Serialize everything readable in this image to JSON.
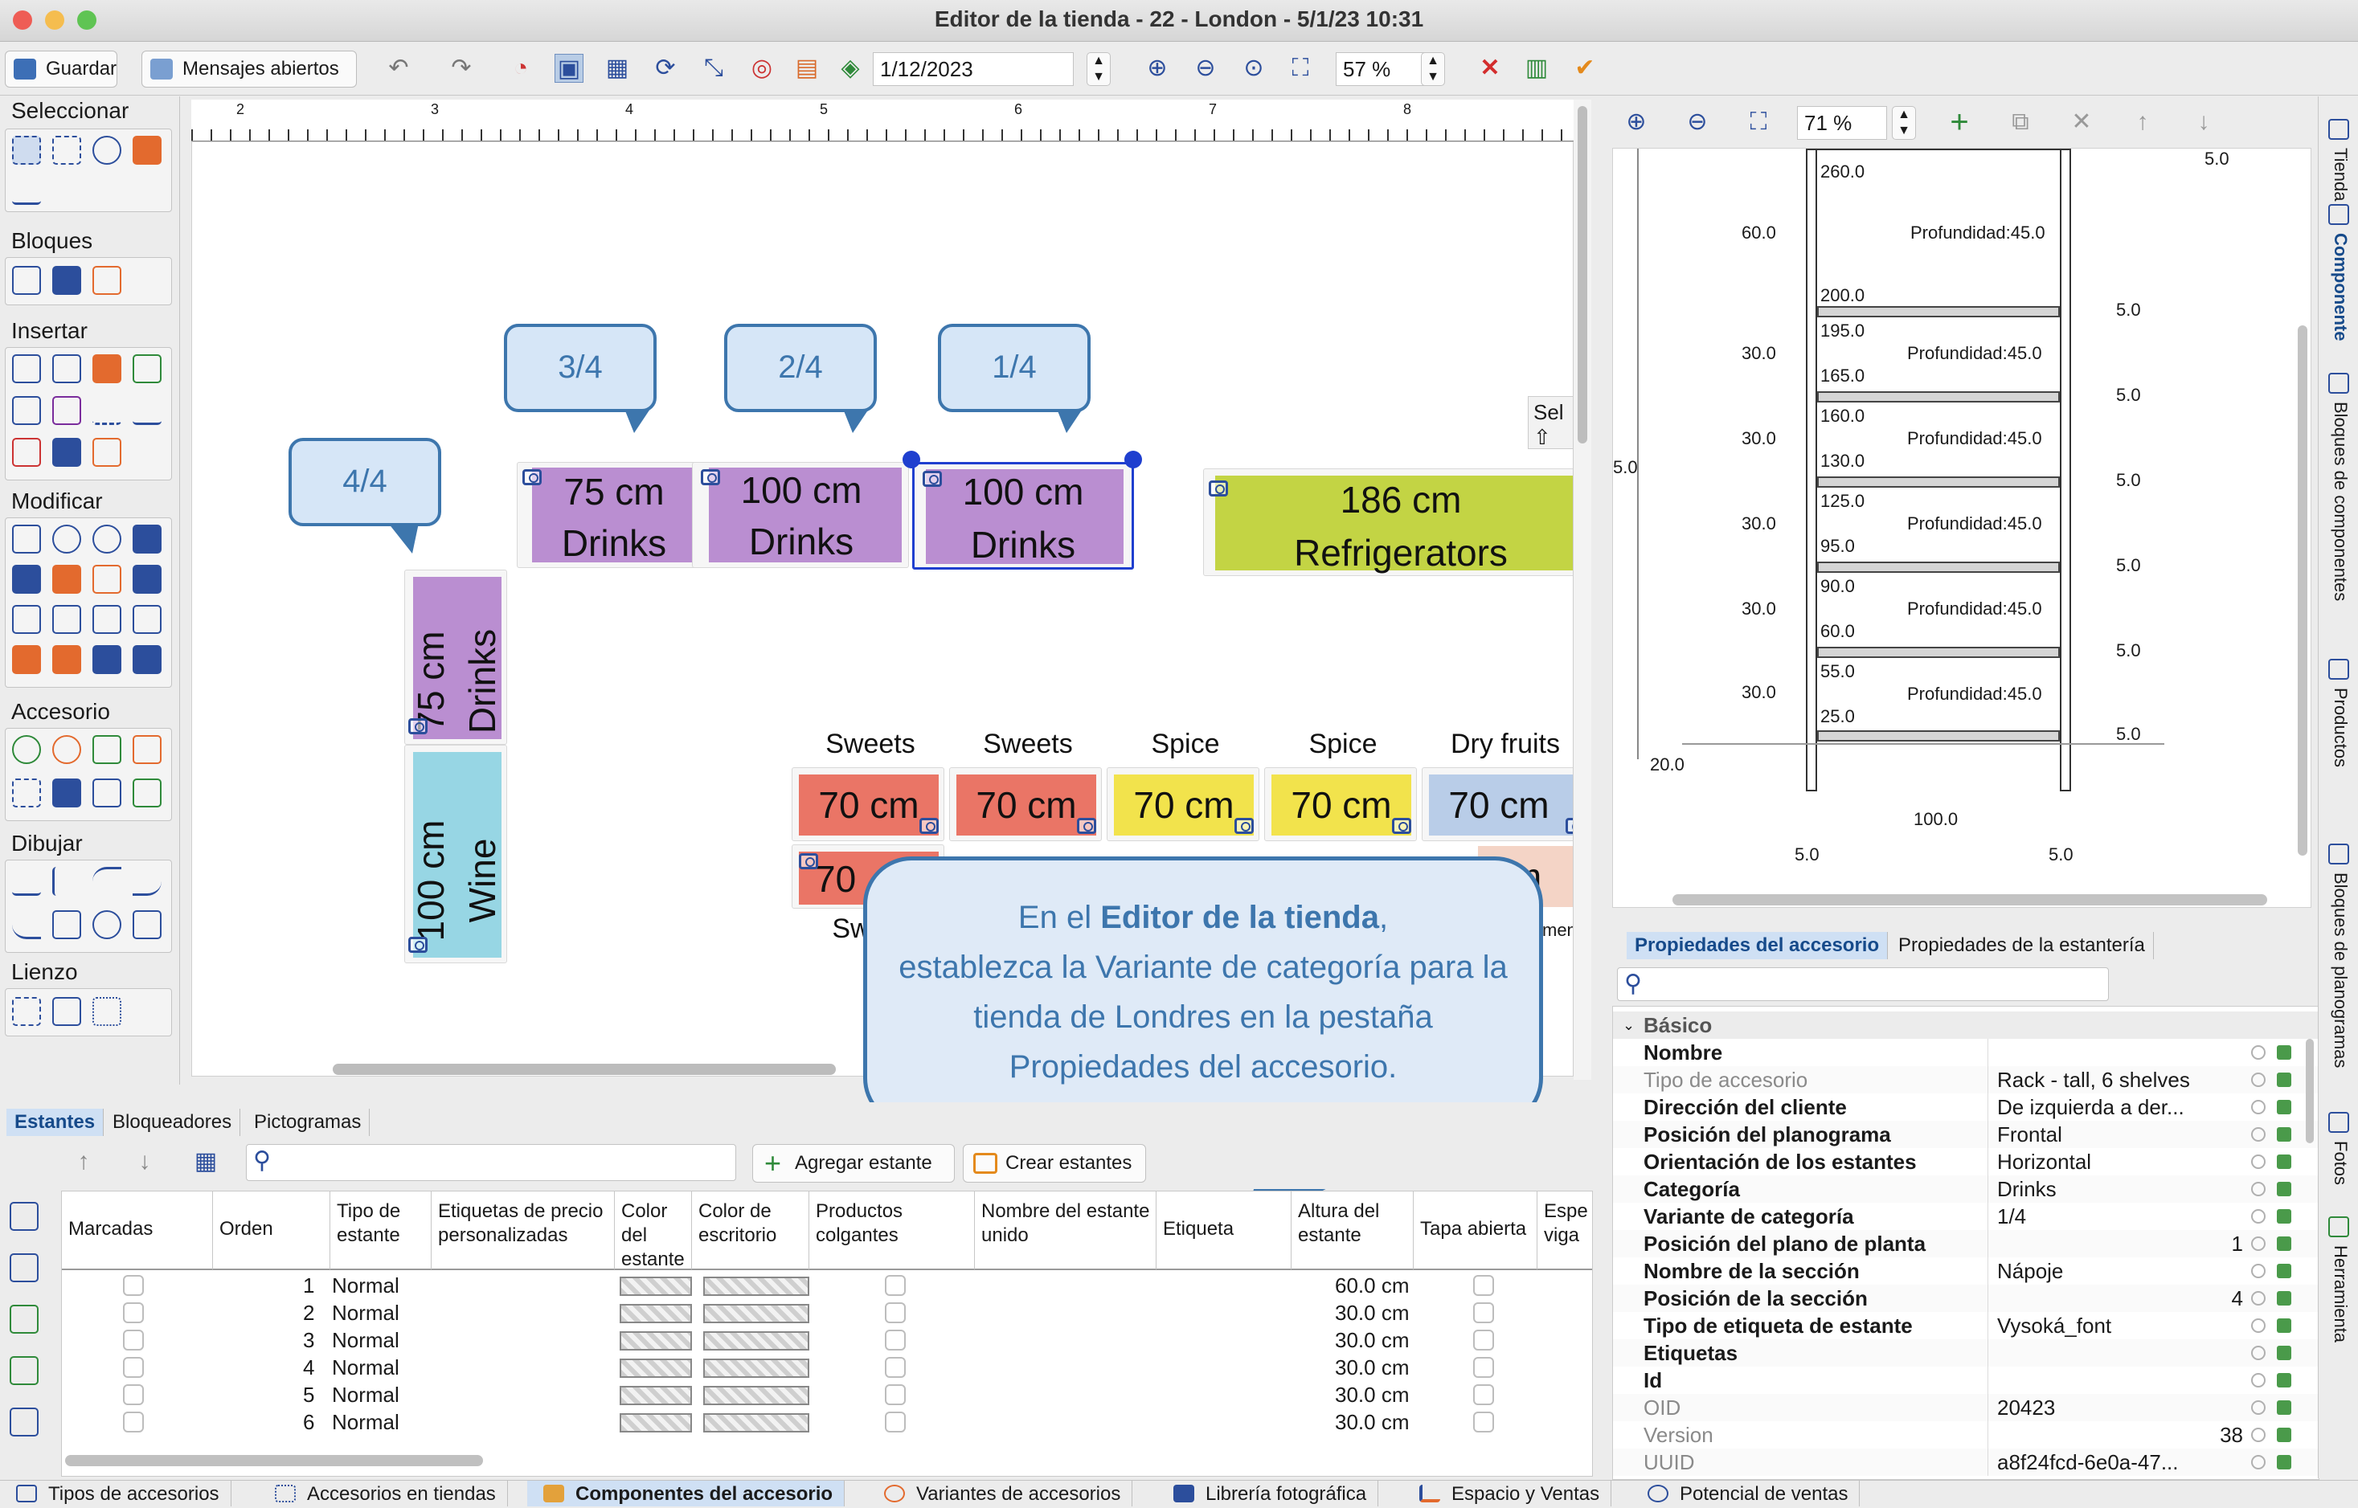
{
  "window": {
    "title": "Editor de la tienda - 22 - London - 5/1/23 10:31"
  },
  "toolbar": {
    "save": "Guardar",
    "messages": "Mensajes abiertos",
    "date": "1/12/2023",
    "zoom": "57 %"
  },
  "left_panel": {
    "sections": [
      "Seleccionar",
      "Bloques",
      "Insertar",
      "Modificar",
      "Accesorio",
      "Dibujar",
      "Lienzo"
    ]
  },
  "ruler": {
    "labels": [
      "2",
      "3",
      "4",
      "5",
      "6",
      "7",
      "8"
    ]
  },
  "canvas": {
    "bubbles": [
      "4/4",
      "3/4",
      "2/4",
      "1/4"
    ],
    "fixtures": [
      {
        "size": "75 cm",
        "cat": "Drinks",
        "color": "#ba8ed1"
      },
      {
        "size": "100 cm",
        "cat": "Drinks",
        "color": "#ba8ed1"
      },
      {
        "size": "100 cm",
        "cat": "Drinks",
        "color": "#ba8ed1"
      },
      {
        "size": "186 cm",
        "cat": "Refrigerators",
        "color": "#c3d444"
      },
      {
        "size": "75 cm",
        "cat": "Drinks",
        "color": "#ba8ed1"
      },
      {
        "size": "100 cm",
        "cat": "Wine",
        "color": "#97d6e4"
      }
    ],
    "bottom_row": [
      {
        "label": "Sweets",
        "size": "70 cm",
        "color": "#ea7566"
      },
      {
        "label": "Sweets",
        "size": "70 cm",
        "color": "#ea7566"
      },
      {
        "label": "Spice",
        "size": "70 cm",
        "color": "#f2e34c"
      },
      {
        "label": "Spice",
        "size": "70 cm",
        "color": "#f2e34c"
      },
      {
        "label": "Dry fruits",
        "size": "70 cm",
        "color": "#b9cde8"
      }
    ],
    "partial": {
      "size": "70",
      "label": "Sw",
      "suffix": "m",
      "suffix2": "men"
    },
    "sel_label": "Sel"
  },
  "callout": {
    "line1a": "En el ",
    "line1b": "Editor de la tienda",
    "line1c": ",",
    "rest": "establezca la Variante de categoría para la tienda de Londres en la pestaña Propiedades del accesorio."
  },
  "bottom_tabs": [
    "Estantes",
    "Bloqueadores",
    "Pictogramas"
  ],
  "shelf_toolbar": {
    "add": "Agregar estante",
    "create": "Crear estantes"
  },
  "table": {
    "headers": [
      "Marcadas",
      "Orden",
      "Tipo de estante",
      "Etiquetas de precio personalizadas",
      "Color del estante",
      "Color de escritorio",
      "Productos colgantes",
      "Nombre del estante unido",
      "Etiqueta",
      "Altura del estante",
      "Tapa abierta",
      "Espe viga"
    ],
    "rows": [
      {
        "order": "1",
        "type": "Normal",
        "height": "60.0 cm"
      },
      {
        "order": "2",
        "type": "Normal",
        "height": "30.0 cm"
      },
      {
        "order": "3",
        "type": "Normal",
        "height": "30.0 cm"
      },
      {
        "order": "4",
        "type": "Normal",
        "height": "30.0 cm"
      },
      {
        "order": "5",
        "type": "Normal",
        "height": "30.0 cm"
      },
      {
        "order": "6",
        "type": "Normal",
        "height": "30.0 cm"
      }
    ]
  },
  "status_tabs": [
    "Tipos de accesorios",
    "Accesorios en tiendas",
    "Componentes del accesorio",
    "Variantes de accesorios",
    "Librería fotográfica",
    "Espacio y Ventas",
    "Potencial de ventas"
  ],
  "right_panel": {
    "zoom": "71 %",
    "drawing": {
      "top_dim": "5.0",
      "depth": "Profundidad:45.0",
      "left_dims": [
        "60.0",
        "30.0",
        "30.0",
        "30.0",
        "30.0",
        "30.0"
      ],
      "right_dims": [
        "5.0",
        "5.0",
        "5.0",
        "5.0",
        "5.0",
        "5.0"
      ],
      "heights": [
        "260.0",
        "200.0",
        "195.0",
        "165.0",
        "160.0",
        "130.0",
        "125.0",
        "95.0",
        "90.0",
        "60.0",
        "55.0",
        "25.0"
      ],
      "side": "5.0",
      "base": "20.0",
      "width": "100.0",
      "foot_l": "5.0",
      "foot_r": "5.0"
    },
    "tabs": [
      "Propiedades del accesorio",
      "Propiedades de la estantería"
    ],
    "group": "Básico",
    "props": [
      {
        "k": "Nombre",
        "v": ""
      },
      {
        "k": "Tipo de accesorio",
        "v": "Rack - tall, 6 shelves",
        "muted": true
      },
      {
        "k": "Dirección del cliente",
        "v": "De izquierda a der..."
      },
      {
        "k": "Posición del planograma",
        "v": "Frontal"
      },
      {
        "k": "Orientación de los estantes",
        "v": "Horizontal"
      },
      {
        "k": "Categoría",
        "v": "Drinks"
      },
      {
        "k": "Variante de categoría",
        "v": "1/4"
      },
      {
        "k": "Posición del plano de planta",
        "v": "1"
      },
      {
        "k": "Nombre de la sección",
        "v": "Nápoje"
      },
      {
        "k": "Posición de la sección",
        "v": "4"
      },
      {
        "k": "Tipo de etiqueta de estante",
        "v": "Vysoká_font"
      },
      {
        "k": "Etiquetas",
        "v": ""
      },
      {
        "k": "Id",
        "v": ""
      },
      {
        "k": "OID",
        "v": "20423",
        "muted": true
      },
      {
        "k": "Version",
        "v": "38",
        "muted": true
      },
      {
        "k": "UUID",
        "v": "a8f24fcd-6e0a-47...",
        "muted": true
      }
    ]
  },
  "side_tabs": [
    "Tienda",
    "Componente",
    "Bloques de componentes",
    "Productos",
    "Bloques de planogramas",
    "Fotos",
    "Herramienta"
  ]
}
